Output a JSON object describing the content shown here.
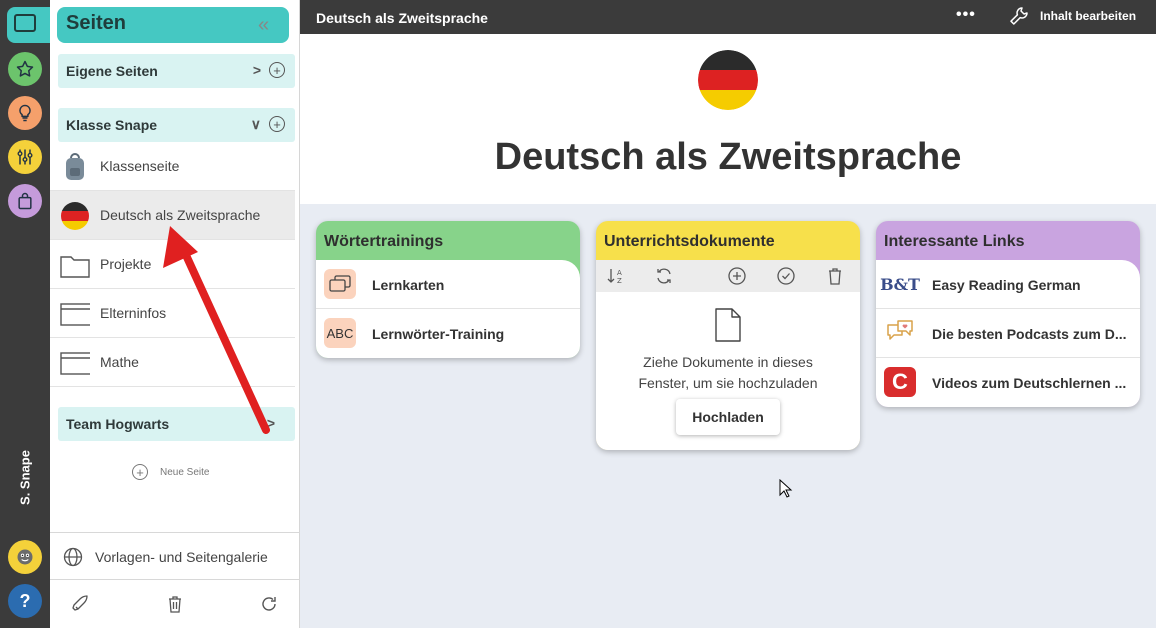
{
  "sidebar": {
    "title": "Seiten",
    "sections": [
      {
        "label": "Eigene Seiten"
      },
      {
        "label": "Klasse Snape"
      },
      {
        "label": "Team Hogwarts"
      }
    ],
    "pages": [
      {
        "label": "Klassenseite",
        "icon": "backpack-icon"
      },
      {
        "label": "Deutsch als Zweitsprache",
        "icon": "german-flag-icon"
      },
      {
        "label": "Projekte",
        "icon": "folder-icon"
      },
      {
        "label": "Elterninfos",
        "icon": "window-icon"
      },
      {
        "label": "Mathe",
        "icon": "window-icon"
      }
    ],
    "new_page": "Neue Seite",
    "gallery": "Vorlagen- und Seitengalerie"
  },
  "rail": {
    "user_name": "S. Snape",
    "help": "?",
    "colors": {
      "pages": "#45c8c2",
      "star": "#6cc46c",
      "bulb": "#f5a06b",
      "sliders": "#f4d13a",
      "bag": "#c59bdb",
      "help": "#2b6cb0"
    }
  },
  "topbar": {
    "title": "Deutsch als Zweitsprache",
    "more": "•••",
    "edit": "Inhalt bearbeiten"
  },
  "page": {
    "title": "Deutsch als Zweitsprache"
  },
  "cards": {
    "woerter": {
      "title": "Wörtertrainings",
      "color": "#87d38a",
      "rows": [
        {
          "label": "Lernkarten",
          "icon": "flashcards-icon"
        },
        {
          "label": "Lernwörter-Training",
          "icon_text": "ABC"
        }
      ]
    },
    "dokumente": {
      "title": "Unterrichtsdokumente",
      "color": "#f7e04b",
      "drop_text_1": "Ziehe Dokumente in dieses",
      "drop_text_2": "Fenster, um sie hochzuladen",
      "upload": "Hochladen"
    },
    "links": {
      "title": "Interessante Links",
      "color": "#c9a4e0",
      "rows": [
        {
          "label": "Easy Reading German",
          "icon_text": "B&T"
        },
        {
          "label": "Die besten Podcasts zum D...",
          "icon": "podcast-chat-icon"
        },
        {
          "label": "Videos zum Deutschlernen ...",
          "icon_text": "C"
        }
      ]
    }
  }
}
